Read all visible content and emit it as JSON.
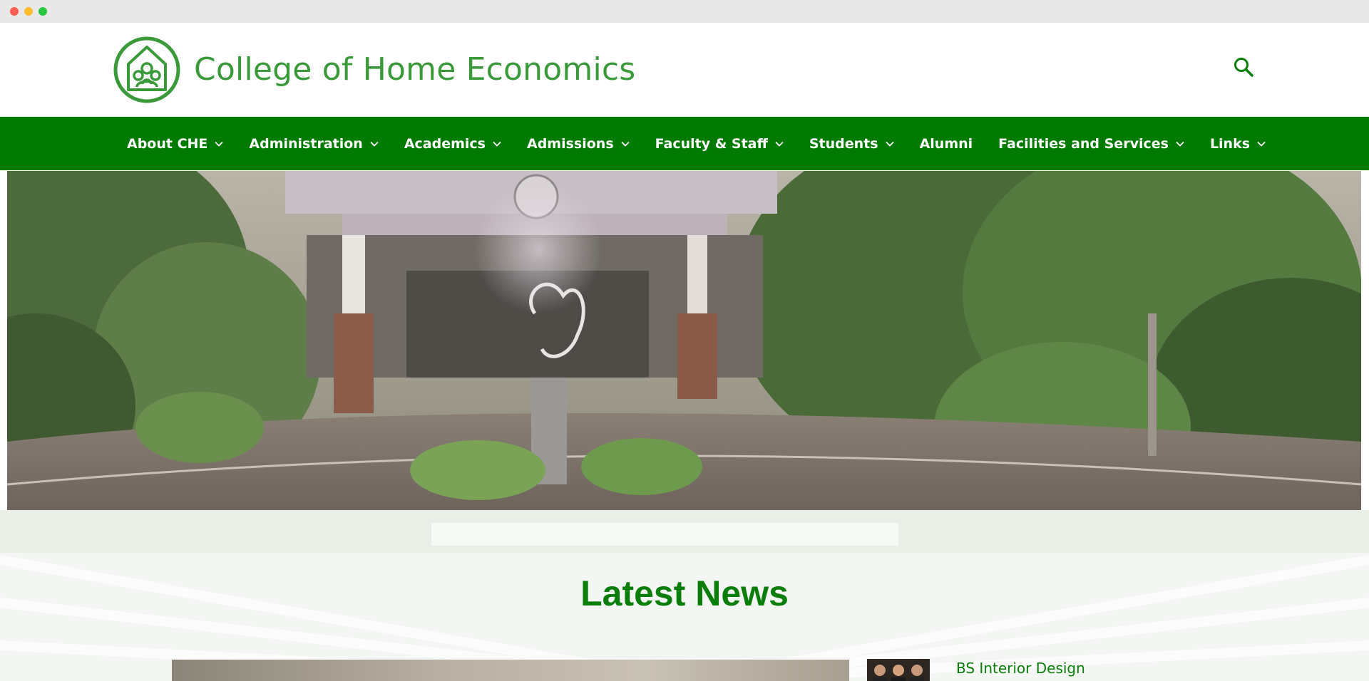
{
  "window": {
    "controls": [
      "close",
      "minimize",
      "maximize"
    ]
  },
  "header": {
    "logo_icon": "house-family-logo-icon",
    "site_title": "College of Home Economics",
    "search_icon": "search-icon"
  },
  "nav": {
    "items": [
      {
        "label": "About CHE",
        "has_dropdown": true
      },
      {
        "label": "Administration",
        "has_dropdown": true
      },
      {
        "label": "Academics",
        "has_dropdown": true
      },
      {
        "label": "Admissions",
        "has_dropdown": true
      },
      {
        "label": "Faculty & Staff",
        "has_dropdown": true
      },
      {
        "label": "Students",
        "has_dropdown": true
      },
      {
        "label": "Alumni",
        "has_dropdown": false
      },
      {
        "label": "Facilities and Services",
        "has_dropdown": true
      },
      {
        "label": "Links",
        "has_dropdown": true
      }
    ]
  },
  "news": {
    "title": "Latest News",
    "items": [
      {
        "title": "BS Interior Design"
      }
    ]
  },
  "colors": {
    "brand_green": "#007a00",
    "title_green": "#3a9a3a",
    "heading_green": "#0a7d0a"
  }
}
